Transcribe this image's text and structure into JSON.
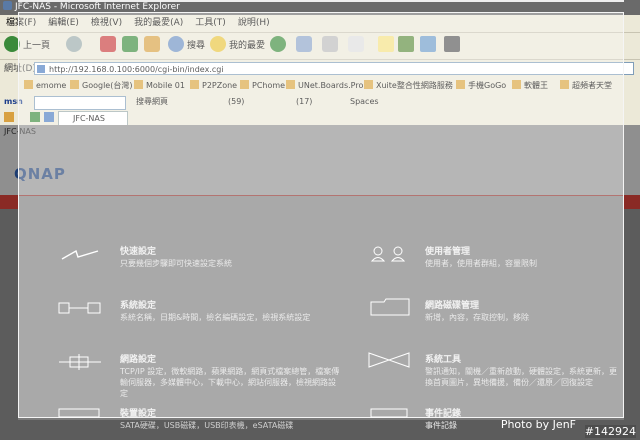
{
  "window": {
    "title": "JFC-NAS - Microsoft Internet Explorer"
  },
  "menu": [
    "檔案(F)",
    "編輯(E)",
    "檢視(V)",
    "我的最愛(A)",
    "工具(T)",
    "說明(H)"
  ],
  "toolbar": {
    "back": "上一頁",
    "search": "搜尋",
    "favorites": "我的最愛"
  },
  "address": {
    "label": "網址(D)",
    "url": "http://192.168.0.100:6000/cgi-bin/index.cgi"
  },
  "links": [
    "emome",
    "Google(台灣)",
    "Mobile 01",
    "P2PZone",
    "PChome",
    "UNet.Boards.Pro",
    "Xuite整合性網路服務",
    "手機GoGo",
    "軟體王",
    "超頻者天堂"
  ],
  "msn": {
    "search_label": "搜尋網頁",
    "mail": "(59)",
    "count": "(17)",
    "spaces": "Spaces"
  },
  "tab": {
    "label": "JFC-NAS"
  },
  "page": {
    "window_name": "JFC-NAS",
    "logo": "QNAP"
  },
  "items": {
    "quick": {
      "title": "快速設定",
      "desc": "只要幾個步驟即可快速設定系統"
    },
    "users": {
      "title": "使用者管理",
      "desc": "使用者，使用者群組，容量限制"
    },
    "system": {
      "title": "系統設定",
      "desc": "系統名稱，日期&時間，檢名編碼設定，檢視系統設定"
    },
    "share": {
      "title": "網路磁碟管理",
      "desc": "新增，內容，存取控制，移除"
    },
    "network": {
      "title": "網路設定",
      "desc": "TCP/IP 設定，微軟網路，蘋果網路，網頁式檔案總管，檔案傳輸伺服器，多媒體中心，下載中心，網站伺服器，檢視網路設定"
    },
    "tools": {
      "title": "系統工具",
      "desc": "警訊通知，關機／重新啟動，硬體設定，系統更新，更換首頁圖片，異地備援，備份／還原／回復設定"
    },
    "devices": {
      "title": "裝置設定",
      "desc": "SATA硬碟，USB磁碟，USB印表機，eSATA磁碟"
    },
    "logs": {
      "title": "事件記錄",
      "desc": "事件記錄"
    }
  },
  "watermark": "Photo by JenF",
  "serial": "#142924"
}
